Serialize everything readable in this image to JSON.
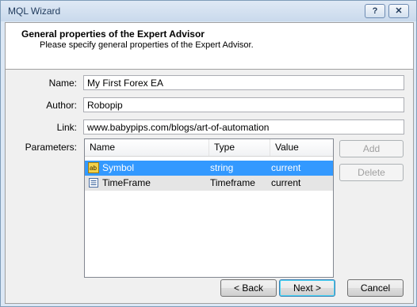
{
  "window": {
    "title": "MQL Wizard",
    "help_label": "?",
    "close_label": "✕"
  },
  "header": {
    "title": "General properties of the Expert Advisor",
    "subtitle": "Please specify general properties of the Expert Advisor."
  },
  "form": {
    "name_label": "Name:",
    "name_value": "My First Forex EA",
    "author_label": "Author:",
    "author_value": "Robopip",
    "link_label": "Link:",
    "link_value": "www.babypips.com/blogs/art-of-automation",
    "parameters_label": "Parameters:"
  },
  "parameters": {
    "columns": [
      "Name",
      "Type",
      "Value"
    ],
    "rows": [
      {
        "name": "Symbol",
        "type": "string",
        "value": "current",
        "icon": "string-param-icon"
      },
      {
        "name": "TimeFrame",
        "type": "Timeframe",
        "value": "current",
        "icon": "enum-param-icon"
      }
    ]
  },
  "side_buttons": {
    "add_label": "Add",
    "delete_label": "Delete"
  },
  "footer": {
    "back_label": "< Back",
    "next_label": "Next >",
    "cancel_label": "Cancel"
  }
}
